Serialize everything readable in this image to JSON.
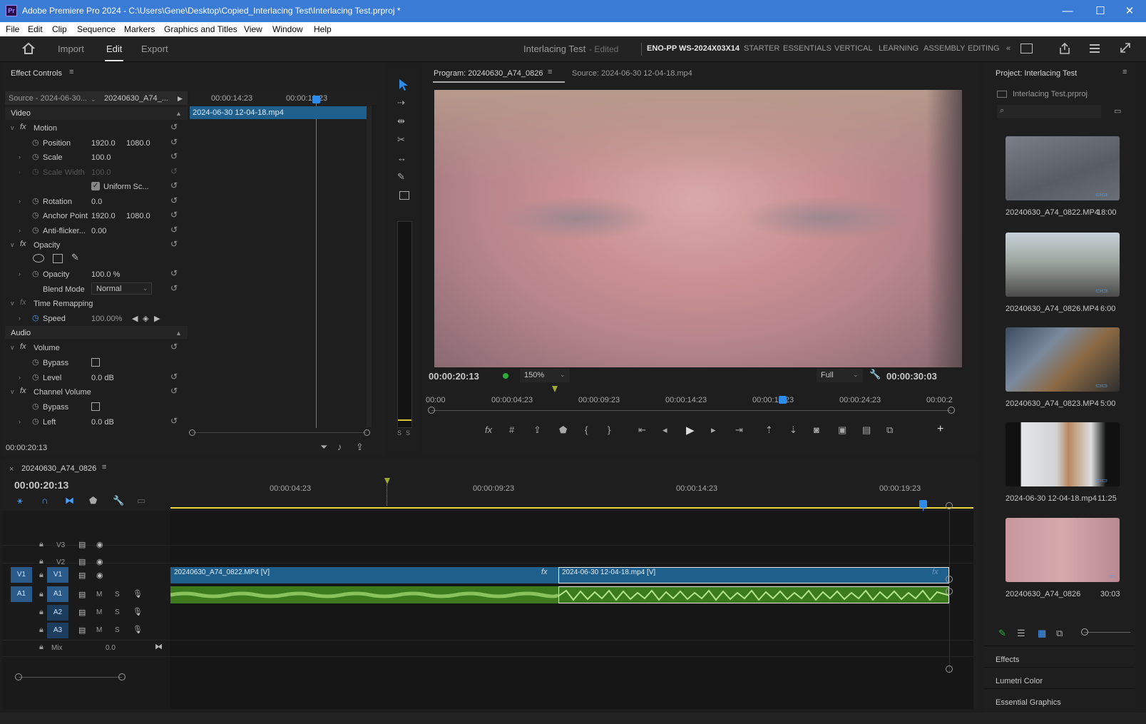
{
  "titlebar": {
    "app_icon": "Pr",
    "title": "Adobe Premiere Pro 2024 - C:\\Users\\Gene\\Desktop\\Copied_Interlacing Test\\Interlacing Test.prproj *",
    "minimize": "—",
    "maximize": "☐",
    "close": "✕"
  },
  "menu": [
    "File",
    "Edit",
    "Clip",
    "Sequence",
    "Markers",
    "Graphics and Titles",
    "View",
    "Window",
    "Help"
  ],
  "topnav": {
    "import": "Import",
    "edit": "Edit",
    "export": "Export",
    "project_name": "Interlacing Test",
    "edited": "- Edited",
    "workspaces": [
      "ENO-PP WS-2024X03X14",
      "STARTER",
      "ESSENTIALS",
      "VERTICAL",
      "LEARNING",
      "ASSEMBLY",
      "EDITING"
    ],
    "more": "«"
  },
  "effect_controls": {
    "title": "Effect Controls",
    "source": "Source - 2024-06-30...",
    "clip": "20240630_A74_...",
    "ruler": [
      "00:00:14:23",
      "00:00:19:23"
    ],
    "clip_bar": "2024-06-30 12-04-18.mp4",
    "video_section": "Video",
    "audio_section": "Audio",
    "motion": "Motion",
    "position_label": "Position",
    "position_x": "1920.0",
    "position_y": "1080.0",
    "scale_label": "Scale",
    "scale": "100.0",
    "scale_width_label": "Scale Width",
    "scale_width": "100.0",
    "uniform_label": "Uniform Sc...",
    "rotation_label": "Rotation",
    "rotation": "0.0",
    "anchor_label": "Anchor Point",
    "anchor_x": "1920.0",
    "anchor_y": "1080.0",
    "antiflicker_label": "Anti-flicker...",
    "antiflicker": "0.00",
    "opacity_fx": "Opacity",
    "opacity_label": "Opacity",
    "opacity": "100.0 %",
    "blend_label": "Blend Mode",
    "blend": "Normal",
    "time_remap": "Time Remapping",
    "speed_label": "Speed",
    "speed": "100.00%",
    "volume": "Volume",
    "bypass_label": "Bypass",
    "level_label": "Level",
    "level": "0.0 dB",
    "channel_volume": "Channel Volume",
    "left_label": "Left",
    "left": "0.0 dB",
    "timecode": "00:00:20:13"
  },
  "program": {
    "title": "Program: 20240630_A74_0826",
    "source_tab": "Source: 2024-06-30 12-04-18.mp4",
    "timecode": "00:00:20:13",
    "zoom": "150%",
    "quality": "Full",
    "duration": "00:00:30:03",
    "ruler": [
      "00:00",
      "00:00:04:23",
      "00:00:09:23",
      "00:00:14:23",
      "00:00:19:23",
      "00:00:24:23",
      "00:00:2"
    ]
  },
  "project": {
    "title": "Project: Interlacing Test",
    "file": "Interlacing Test.prproj",
    "items": [
      {
        "name": "20240630_A74_0822.MP4",
        "duration": "18:00"
      },
      {
        "name": "20240630_A74_0826.MP4",
        "duration": "6:00"
      },
      {
        "name": "20240630_A74_0823.MP4",
        "duration": "5:00"
      },
      {
        "name": "2024-06-30 12-04-18.mp4",
        "duration": "11:25"
      },
      {
        "name": "20240630_A74_0826",
        "duration": "30:03"
      }
    ],
    "panels": [
      "Effects",
      "Lumetri Color",
      "Essential Graphics"
    ]
  },
  "timeline": {
    "sequence": "20240630_A74_0826",
    "timecode": "00:00:20:13",
    "ruler": [
      "00:00:04:23",
      "00:00:09:23",
      "00:00:14:23",
      "00:00:19:23"
    ],
    "tracks": {
      "v3": "V3",
      "v2": "V2",
      "v1": "V1",
      "a1": "A1",
      "a2": "A2",
      "a3": "A3",
      "mix": "Mix",
      "mix_val": "0.0"
    },
    "clip1": "20240630_A74_0822.MP4 [V]",
    "clip2": "2024-06-30 12-04-18.mp4 [V]",
    "m": "M",
    "s": "S"
  },
  "colors": {
    "accent": "#2d8ceb",
    "clip_video": "#1f5f8b",
    "clip_audio": "#3c7a1e",
    "titlebar": "#3a7bd5"
  }
}
